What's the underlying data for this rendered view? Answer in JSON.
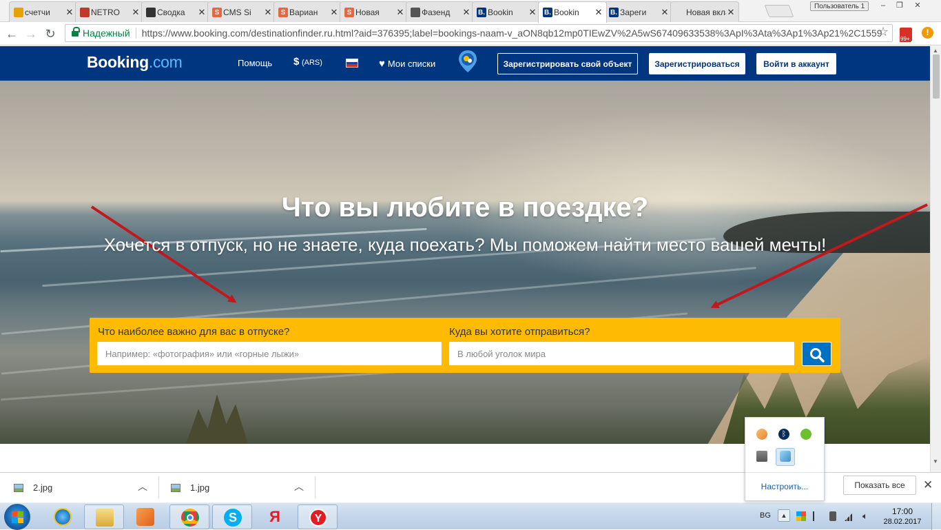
{
  "browser": {
    "tabs": [
      {
        "label": "счетчи",
        "favicon": "chart-favicon-icon",
        "color": "#e8a200"
      },
      {
        "label": "NETRO",
        "favicon": "diamond-favicon-icon",
        "color": "#c0392b"
      },
      {
        "label": "Сводка",
        "favicon": "code-favicon-icon",
        "color": "#333333"
      },
      {
        "label": "CMS Si",
        "favicon": "s-favicon-icon",
        "color": "#e8663d",
        "glyph": "S"
      },
      {
        "label": "Вариан",
        "favicon": "s-favicon-icon",
        "color": "#e8663d",
        "glyph": "S"
      },
      {
        "label": "Новая",
        "favicon": "s-favicon-icon",
        "color": "#e8663d",
        "glyph": "S"
      },
      {
        "label": "Фазенд",
        "favicon": "house-favicon-icon",
        "color": "#555555"
      },
      {
        "label": "Bookin",
        "favicon": "booking-favicon-icon",
        "color": "#003580",
        "glyph": "B."
      },
      {
        "label": "Bookin",
        "favicon": "booking-favicon-icon",
        "color": "#003580",
        "glyph": "B.",
        "active": true
      },
      {
        "label": "Зареги",
        "favicon": "booking-favicon-icon",
        "color": "#003580",
        "glyph": "B."
      },
      {
        "label": "Новая вкла",
        "favicon": "none",
        "color": "#ffffff"
      }
    ],
    "profile_label": "Пользователь 1",
    "window_controls": {
      "minimize": "–",
      "restore": "❐",
      "close": "✕"
    },
    "secure_label": "Надежный",
    "url": "https://www.booking.com/destinationfinder.ru.html?aid=376395;label=bookings-naam-v_aON8qb12mp0TIEwZV%2A5wS67409633538%3ApI%3Ata%3Ap1%3Ap21%2C1559",
    "ext_badge": "99+",
    "alert_glyph": "!"
  },
  "booking": {
    "logo_main": "Booking",
    "logo_suffix": ".com",
    "nav": {
      "help": "Помощь",
      "currency_symbol": "$",
      "currency_code": "(ARS)",
      "wishlists": "Мои списки"
    },
    "buttons": {
      "list_property": "Зарегистрировать свой объект",
      "register": "Зарегистрироваться",
      "login": "Войти в аккаунт"
    },
    "brand_color": "#003580",
    "accent_color": "#febb02",
    "hero": {
      "title": "Что вы любите в поездке?",
      "subtitle": "Хочется в отпуск, но не знаете, куда поехать? Мы поможем найти место вашей мечты!"
    },
    "search": {
      "interest_label": "Что наиболее важно для вас в отпуске?",
      "interest_placeholder": "Например: «фотография» или «горные лыжи»",
      "destination_label": "Куда вы хотите отправиться?",
      "destination_placeholder": "В любой уголок мира"
    }
  },
  "tray_popup": {
    "configure": "Настроить..."
  },
  "downloads": {
    "items": [
      {
        "name": "2.jpg"
      },
      {
        "name": "1.jpg"
      }
    ],
    "show_all": "Показать все",
    "close_glyph": "✕"
  },
  "taskbar": {
    "language": "BG",
    "time": "17:00",
    "date": "28.02.2017"
  }
}
